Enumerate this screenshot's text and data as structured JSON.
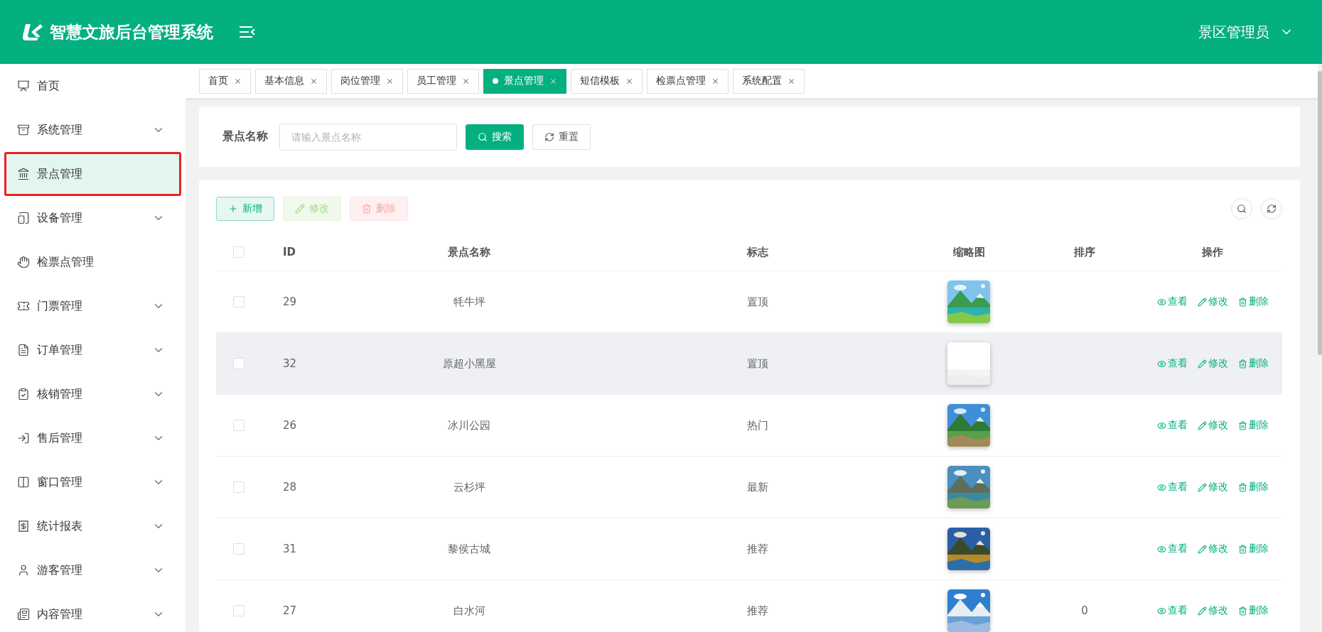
{
  "header": {
    "title": "智慧文旅后台管理系统",
    "user": "景区管理员"
  },
  "sidebar": {
    "items": [
      {
        "label": "首页",
        "expandable": false,
        "selected": false
      },
      {
        "label": "系统管理",
        "expandable": true,
        "selected": false
      },
      {
        "label": "景点管理",
        "expandable": false,
        "selected": true
      },
      {
        "label": "设备管理",
        "expandable": true,
        "selected": false
      },
      {
        "label": "检票点管理",
        "expandable": false,
        "selected": false
      },
      {
        "label": "门票管理",
        "expandable": true,
        "selected": false
      },
      {
        "label": "订单管理",
        "expandable": true,
        "selected": false
      },
      {
        "label": "核销管理",
        "expandable": true,
        "selected": false
      },
      {
        "label": "售后管理",
        "expandable": true,
        "selected": false
      },
      {
        "label": "窗口管理",
        "expandable": true,
        "selected": false
      },
      {
        "label": "统计报表",
        "expandable": true,
        "selected": false
      },
      {
        "label": "游客管理",
        "expandable": true,
        "selected": false
      },
      {
        "label": "内容管理",
        "expandable": true,
        "selected": false
      }
    ]
  },
  "tabs": [
    {
      "label": "首页",
      "selected": false
    },
    {
      "label": "基本信息",
      "selected": false
    },
    {
      "label": "岗位管理",
      "selected": false
    },
    {
      "label": "员工管理",
      "selected": false
    },
    {
      "label": "景点管理",
      "selected": true
    },
    {
      "label": "短信模板",
      "selected": false
    },
    {
      "label": "检票点管理",
      "selected": false
    },
    {
      "label": "系统配置",
      "selected": false
    }
  ],
  "search": {
    "label": "景点名称",
    "placeholder": "请输入景点名称",
    "buttons": [
      {
        "kind": "search",
        "label": "搜索"
      },
      {
        "kind": "reset",
        "label": "重置"
      }
    ]
  },
  "toolbar": {
    "buttons": [
      {
        "kind": "add",
        "label": "新增",
        "disabled": false
      },
      {
        "kind": "edit",
        "label": "修改",
        "disabled": true
      },
      {
        "kind": "delete",
        "label": "删除",
        "disabled": true
      }
    ]
  },
  "table": {
    "all_checked": false,
    "columns": [
      "ID",
      "景点名称",
      "标志",
      "缩略图",
      "排序",
      "操作"
    ],
    "rows": [
      {
        "id": "29",
        "name": "牦牛坪",
        "tag": "置顶",
        "checked": false,
        "highlighted": false,
        "actions": [
          {
            "kind": "view",
            "label": "查看"
          },
          {
            "kind": "edit",
            "label": "修改"
          },
          {
            "kind": "delete",
            "label": "删除"
          }
        ]
      },
      {
        "id": "32",
        "name": "原超小黑屋",
        "tag": "置顶",
        "checked": false,
        "highlighted": true,
        "actions": [
          {
            "kind": "view",
            "label": "查看"
          },
          {
            "kind": "edit",
            "label": "修改"
          },
          {
            "kind": "delete",
            "label": "删除"
          }
        ]
      },
      {
        "id": "26",
        "name": "冰川公园",
        "tag": "热门",
        "checked": false,
        "highlighted": false,
        "actions": [
          {
            "kind": "view",
            "label": "查看"
          },
          {
            "kind": "edit",
            "label": "修改"
          },
          {
            "kind": "delete",
            "label": "删除"
          }
        ]
      },
      {
        "id": "28",
        "name": "云杉坪",
        "tag": "最新",
        "checked": false,
        "highlighted": false,
        "actions": [
          {
            "kind": "view",
            "label": "查看"
          },
          {
            "kind": "edit",
            "label": "修改"
          },
          {
            "kind": "delete",
            "label": "删除"
          }
        ]
      },
      {
        "id": "31",
        "name": "黎侯古城",
        "tag": "推荐",
        "checked": false,
        "highlighted": false,
        "actions": [
          {
            "kind": "view",
            "label": "查看"
          },
          {
            "kind": "edit",
            "label": "修改"
          },
          {
            "kind": "delete",
            "label": "删除"
          }
        ]
      },
      {
        "id": "27",
        "name": "白水河",
        "tag": "推荐",
        "sort": "0",
        "checked": false,
        "highlighted": false,
        "actions": [
          {
            "kind": "view",
            "label": "查看"
          },
          {
            "kind": "edit",
            "label": "修改"
          },
          {
            "kind": "delete",
            "label": "删除"
          }
        ]
      }
    ]
  }
}
